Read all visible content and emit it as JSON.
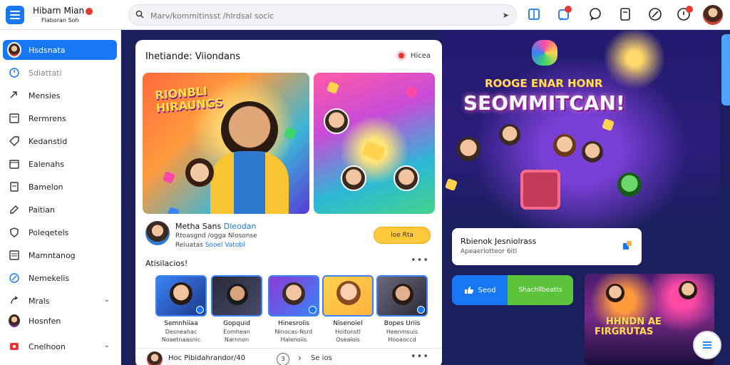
{
  "header": {
    "app_name": "Hibarn Mian",
    "app_subtitle": "Flaboran Soh",
    "search_placeholder": "Marv/kommitinsst /hlrdsal socic",
    "icons": [
      "book-icon",
      "notification-icon",
      "chat-icon",
      "document-icon",
      "edit-icon",
      "alert-icon",
      "profile-avatar"
    ]
  },
  "sidebar": {
    "items": [
      {
        "label": "Hsdsnata",
        "icon": "avatar",
        "active": true
      },
      {
        "label": "Sdiattati",
        "icon": "clock-icon"
      },
      {
        "label": "Mensies",
        "icon": "link-icon"
      },
      {
        "label": "Rermrens",
        "icon": "list-icon"
      },
      {
        "label": "Kedanstid",
        "icon": "tag-icon"
      },
      {
        "label": "Ealenahs",
        "icon": "calendar-icon"
      },
      {
        "label": "Bamelon",
        "icon": "page-icon"
      },
      {
        "label": "Paitian",
        "icon": "edit-icon"
      },
      {
        "label": "Poleqetels",
        "icon": "shield-icon"
      },
      {
        "label": "Mamntanog",
        "icon": "menu-icon"
      },
      {
        "label": "Nemekelis",
        "icon": "link-icon"
      },
      {
        "label": "Mrals",
        "icon": "arrow-icon",
        "chevron": true
      },
      {
        "label": "Hosnfen",
        "icon": "avatar"
      },
      {
        "label": "Cnelhoon",
        "icon": "flag-icon",
        "chevron": true
      }
    ]
  },
  "feed": {
    "title": "Ihetiande: Viiondans",
    "toggle_label": "Hicea",
    "hero_title": "RIONBLI HIRAUNGS",
    "post": {
      "name": "Metha Sans",
      "name_link": "Dleodan",
      "line2": "Rtoasgnd /ogga Nlosonse",
      "line3": "Reiuatas",
      "line3_link": "Sooel Vatobl",
      "pill": "Ioe  Rta"
    },
    "section_label": "Atisilacios!",
    "thumbnails": [
      {
        "name": "Semnhiiaa",
        "sub": "Desneahac",
        "sub2": "Noaetnaasnic"
      },
      {
        "name": "Gopquid",
        "sub": "Eomhean",
        "sub2": "Narnnon"
      },
      {
        "name": "Hinesroiis",
        "sub": "Ninocas-Nsnt",
        "sub2": "Halenoiis"
      },
      {
        "name": "Nisenoiel",
        "sub": "Hoitonstl",
        "sub2": "Oseaiois"
      },
      {
        "name": "Bopes Uriis",
        "sub": "Heenmsuis",
        "sub2": "Hooaoccd"
      }
    ],
    "footer": {
      "text": "Hoc Pibidahrandor/40",
      "control": "3",
      "right": "Se ios"
    }
  },
  "promo": {
    "headline_small": "ROOGE ENAR HONR",
    "headline_big": "SEOMMITCAN!",
    "card_title": "Rbienok Jesniolrass",
    "card_sub": "Apeaeriotteor 6itl",
    "btn_blue": "Seod",
    "btn_green": "Shachllbeatts",
    "concert_line1": "HHNDN AE",
    "concert_line2": "FIRGRUTAS"
  },
  "colors": {
    "accent": "#1877f2",
    "background": "#1b1f5c",
    "green": "#5bc43a",
    "yellow": "#ffc83d",
    "badge": "#e53935"
  }
}
